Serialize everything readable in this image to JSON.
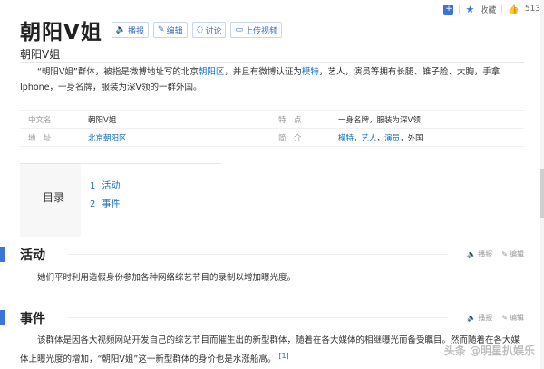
{
  "toolbar": {
    "collect_label": "收藏",
    "like_count": "513"
  },
  "header": {
    "title": "朝阳V姐",
    "buttons": [
      {
        "icon": "speaker-icon",
        "glyph": "🔈",
        "label": "播报"
      },
      {
        "icon": "pencil-icon",
        "glyph": "✎",
        "label": "编辑"
      },
      {
        "icon": "chat-bubble-icon",
        "glyph": "◌",
        "label": "讨论"
      },
      {
        "icon": "video-icon",
        "glyph": "▭",
        "label": "上传视频"
      }
    ],
    "subtitle": "朝阳V姐"
  },
  "summary": {
    "part1": "“朝阳V姐”群体，被指是微博地址写的北京",
    "link1": "朝阳区",
    "part2": "，并且有微博认证为",
    "link2": "模特",
    "part3": "，艺人，演员等拥有长腿、锥子脸、大胸，手拿Iphone，一身名牌，服装为深V领的一群外国。"
  },
  "info": {
    "rows": [
      {
        "k1": "中文名",
        "v1": "朝阳V姐",
        "k2": "特　点",
        "v2": "一身名牌，服装为深V领"
      },
      {
        "k1": "地　址",
        "v1_link": "北京朝阳区",
        "k2": "简　介",
        "links": [
          "模特",
          "艺人",
          "演员"
        ],
        "tail": "，外国"
      }
    ]
  },
  "toc": {
    "label": "目录",
    "items": [
      {
        "num": "1",
        "text": "活动"
      },
      {
        "num": "2",
        "text": "事件"
      }
    ]
  },
  "sections": [
    {
      "title": "活动",
      "tools": [
        "播报",
        "编辑"
      ],
      "text": "她们平时利用造假身份参加各种网络综艺节目的录制以增加曝光度。"
    },
    {
      "title": "事件",
      "tools": [
        "播报",
        "编辑"
      ],
      "text": "该群体是因各大视频网站开发自己的综艺节目而催生出的新型群体，随着在各大媒体的相继曝光而备受瞩目。然而随着在各大媒体上曝光度的增加，“朝阳V姐”这一新型群体的身价也是水涨船高。",
      "ref": "[1]"
    }
  ],
  "watermark": "头条 @明星扒娱乐"
}
